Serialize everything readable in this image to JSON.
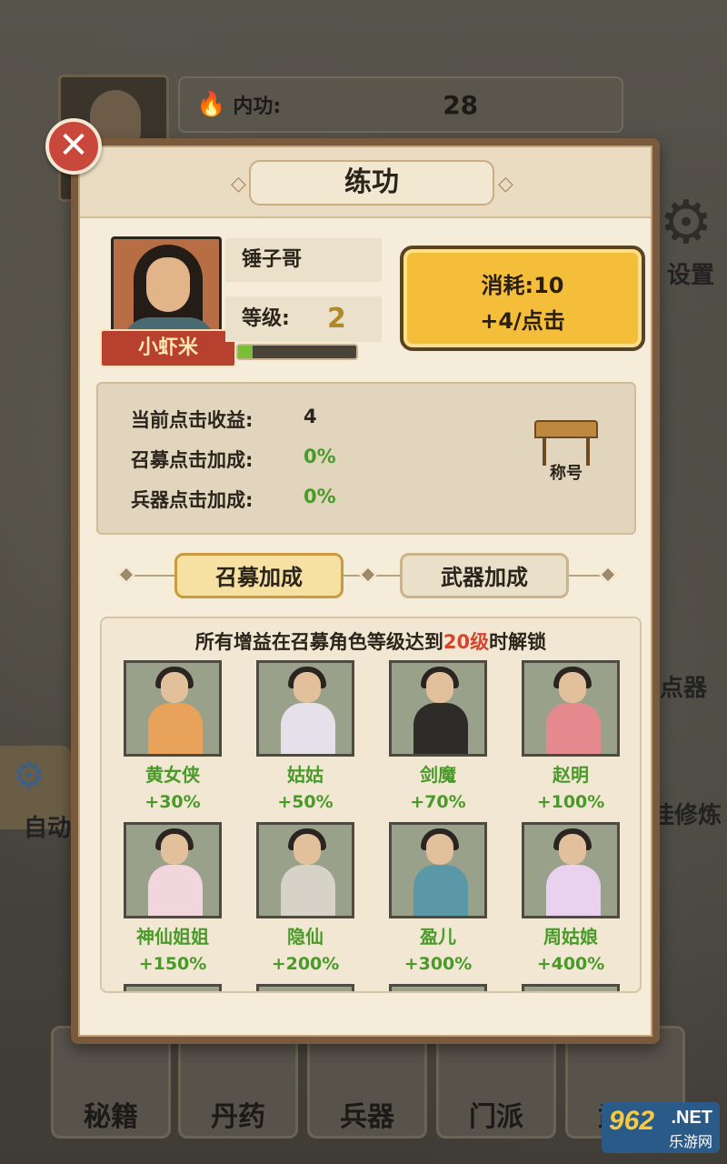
{
  "background": {
    "stat_label": "内功:",
    "stat_value": "28",
    "settings_label": "设置",
    "clicker_label": "点器",
    "cultivate_label": "挂修炼",
    "auto_label": "自动",
    "bottom_nav": [
      "秘籍",
      "丹药",
      "兵器",
      "门派",
      "武功"
    ],
    "watermark_main": "962",
    "watermark_net": ".NET",
    "watermark_sub": "乐游网"
  },
  "dialog": {
    "title": "练功",
    "close_icon": "close-icon",
    "character": {
      "name": "锤子哥",
      "rank": "小虾米",
      "level_label": "等级:",
      "level_value": "2",
      "xp_fraction": 0.12
    },
    "cost_button": {
      "line1": "消耗:10",
      "line2": "+4/点击"
    },
    "stats": [
      {
        "label": "当前点击收益:",
        "value": "4",
        "color": "#2a241b"
      },
      {
        "label": "召募点击加成:",
        "value": "0%",
        "color": "#4a9a2a"
      },
      {
        "label": "兵器点击加成:",
        "value": "0%",
        "color": "#4a9a2a"
      }
    ],
    "title_button": "称号",
    "tabs": [
      {
        "label": "召募加成",
        "active": true
      },
      {
        "label": "武器加成",
        "active": false
      }
    ],
    "recruit_note": {
      "prefix": "所有增益在召募角色等级达到",
      "highlight": "20级",
      "suffix": "时解锁"
    },
    "recruits": [
      {
        "name": "黄女侠",
        "bonus": "+30%",
        "robe": "#e8a25a"
      },
      {
        "name": "姑姑",
        "bonus": "+50%",
        "robe": "#e6e0ea"
      },
      {
        "name": "剑魔",
        "bonus": "+70%",
        "robe": "#2e2b28"
      },
      {
        "name": "赵明",
        "bonus": "+100%",
        "robe": "#e48a8e"
      },
      {
        "name": "神仙姐姐",
        "bonus": "+150%",
        "robe": "#f1d6dc"
      },
      {
        "name": "隐仙",
        "bonus": "+200%",
        "robe": "#d6d2c8"
      },
      {
        "name": "盈儿",
        "bonus": "+300%",
        "robe": "#5a98a8"
      },
      {
        "name": "周姑娘",
        "bonus": "+400%",
        "robe": "#e9d2ee"
      }
    ]
  }
}
